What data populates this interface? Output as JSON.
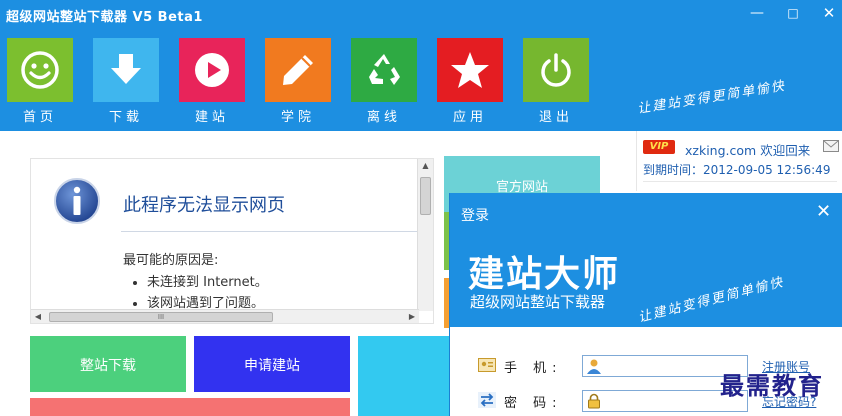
{
  "window": {
    "title": "超级网站整站下载器 V5 Beta1",
    "controls": {
      "minimize": "—",
      "maximize": "□",
      "close": "✕"
    }
  },
  "nav": [
    {
      "label": "首页",
      "icon": "smiley-icon",
      "color": "#7cbf2f"
    },
    {
      "label": "下载",
      "icon": "download-arrow-icon",
      "color": "#3fb6ee"
    },
    {
      "label": "建站",
      "icon": "play-icon",
      "color": "#e8245a"
    },
    {
      "label": "学院",
      "icon": "pencil-icon",
      "color": "#f17a1f"
    },
    {
      "label": "离线",
      "icon": "recycle-icon",
      "color": "#2eaa43"
    },
    {
      "label": "应用",
      "icon": "star-icon",
      "color": "#e41d22"
    },
    {
      "label": "退出",
      "icon": "power-icon",
      "color": "#76b72f"
    }
  ],
  "slogan": "让建站变得更简单愉快",
  "browser_error": {
    "title": "此程序无法显示网页",
    "reason_label": "最可能的原因是:",
    "reasons": [
      "未连接到 Internet。",
      "该网站遇到了问题。"
    ],
    "scroll_grip": "III"
  },
  "tiles": {
    "official": "官方网站",
    "download": "整站下载",
    "apply": "申请建站"
  },
  "user": {
    "vip_badge": "VIP",
    "site": "xzking.com",
    "welcome": "欢迎回来",
    "expire": "到期时间：2012-09-05 12:56:49"
  },
  "login": {
    "title": "登录",
    "close": "✕",
    "brand_name": "建站大师",
    "brand_sub": "超级网站整站下载器",
    "brand_slogan": "让建站变得更简单愉快",
    "phone_label": "手 机:",
    "password_label": "密 码:",
    "register_link": "注册账号",
    "forgot_link": "忘记密码?"
  },
  "watermark": "最需教育",
  "colors": {
    "header_blue": "#1d8fe1",
    "link_blue": "#1f5fb0",
    "tile_cyan": "#6cd2d6",
    "tile_green": "#4cd07d",
    "tile_blue": "#3232f0",
    "vip_red": "#e02a10"
  }
}
